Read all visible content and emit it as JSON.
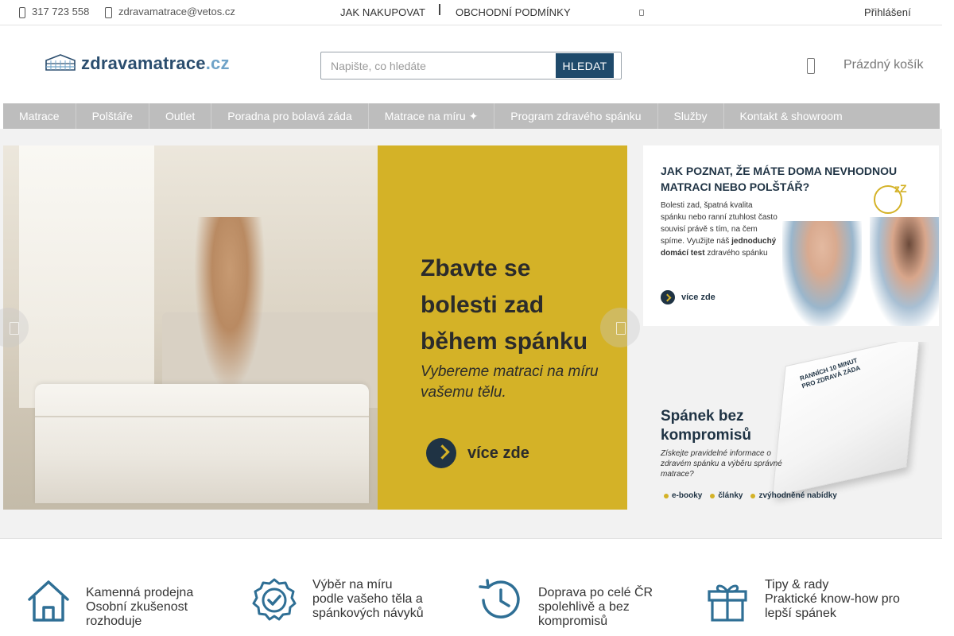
{
  "topbar": {
    "phone": "317 723 558",
    "email": "zdravamatrace@vetos.cz",
    "link_how_to_buy": "JAK NAKUPOVAT",
    "link_terms": "OBCHODNÍ PODMÍNKY",
    "login": "Přihlášení"
  },
  "header": {
    "logo_main": "zdravamatrace",
    "logo_tld": ".cz",
    "search_placeholder": "Napište, co hledáte",
    "search_button": "HLEDAT",
    "cart_label": "Prázdný košík"
  },
  "nav": {
    "items": [
      {
        "label": "Matrace"
      },
      {
        "label": "Polštáře"
      },
      {
        "label": "Outlet"
      },
      {
        "label": "Poradna pro bolavá záda"
      },
      {
        "label": "Matrace na míru ✦"
      },
      {
        "label": "Program zdravého spánku"
      },
      {
        "label": "Služby"
      },
      {
        "label": "Kontakt & showroom"
      }
    ]
  },
  "hero": {
    "headline": "Zbavte se bolesti zad během spánku",
    "sub": "Vybereme matraci na míru vašemu tělu.",
    "cta": "více zde"
  },
  "banner1": {
    "title": "JAK POZNAT, ŽE MÁTE DOMA NEVHODNOU MATRACI NEBO POLŠTÁŘ?",
    "body_1": "Bolesti zad, špatná kvalita spánku nebo ranní ztuhlost často souvisí právě s tím, na čem spíme. Využijte náš",
    "body_bold": "jednoduchý domácí test",
    "body_2": "zdravého spánku",
    "more": "více zde",
    "zzz": "zZ"
  },
  "banner2": {
    "title": "Spánek bez kompromisů",
    "body": "Získejte pravidelné informace o zdravém spánku a výběru správné matrace?",
    "tags": [
      "e-booky",
      "články",
      "zvýhodněné nabídky"
    ],
    "book_title": "RANNÍCH 10 MINUT PRO ZDRAVÁ ZÁDA"
  },
  "features": [
    {
      "title": "Kamenná prodejna",
      "desc": "Osobní zkušenost rozhoduje",
      "icon": "house-icon"
    },
    {
      "title": "Výběr na míru",
      "desc": "podle vašeho těla a spánkových návyků",
      "icon": "badge-check-icon"
    },
    {
      "title": "Doprava po celé ČR",
      "desc": "spolehlivě a bez kompromisů",
      "icon": "clock-history-icon"
    },
    {
      "title": "Tipy & rady",
      "desc": "Praktické know-how pro lepší spánek",
      "icon": "gift-icon"
    }
  ],
  "colors": {
    "brand_dark": "#1f4a6b",
    "accent_yellow": "#d4b227",
    "nav_bg": "#bdbdbd",
    "feature_icon": "#2f6f95"
  }
}
